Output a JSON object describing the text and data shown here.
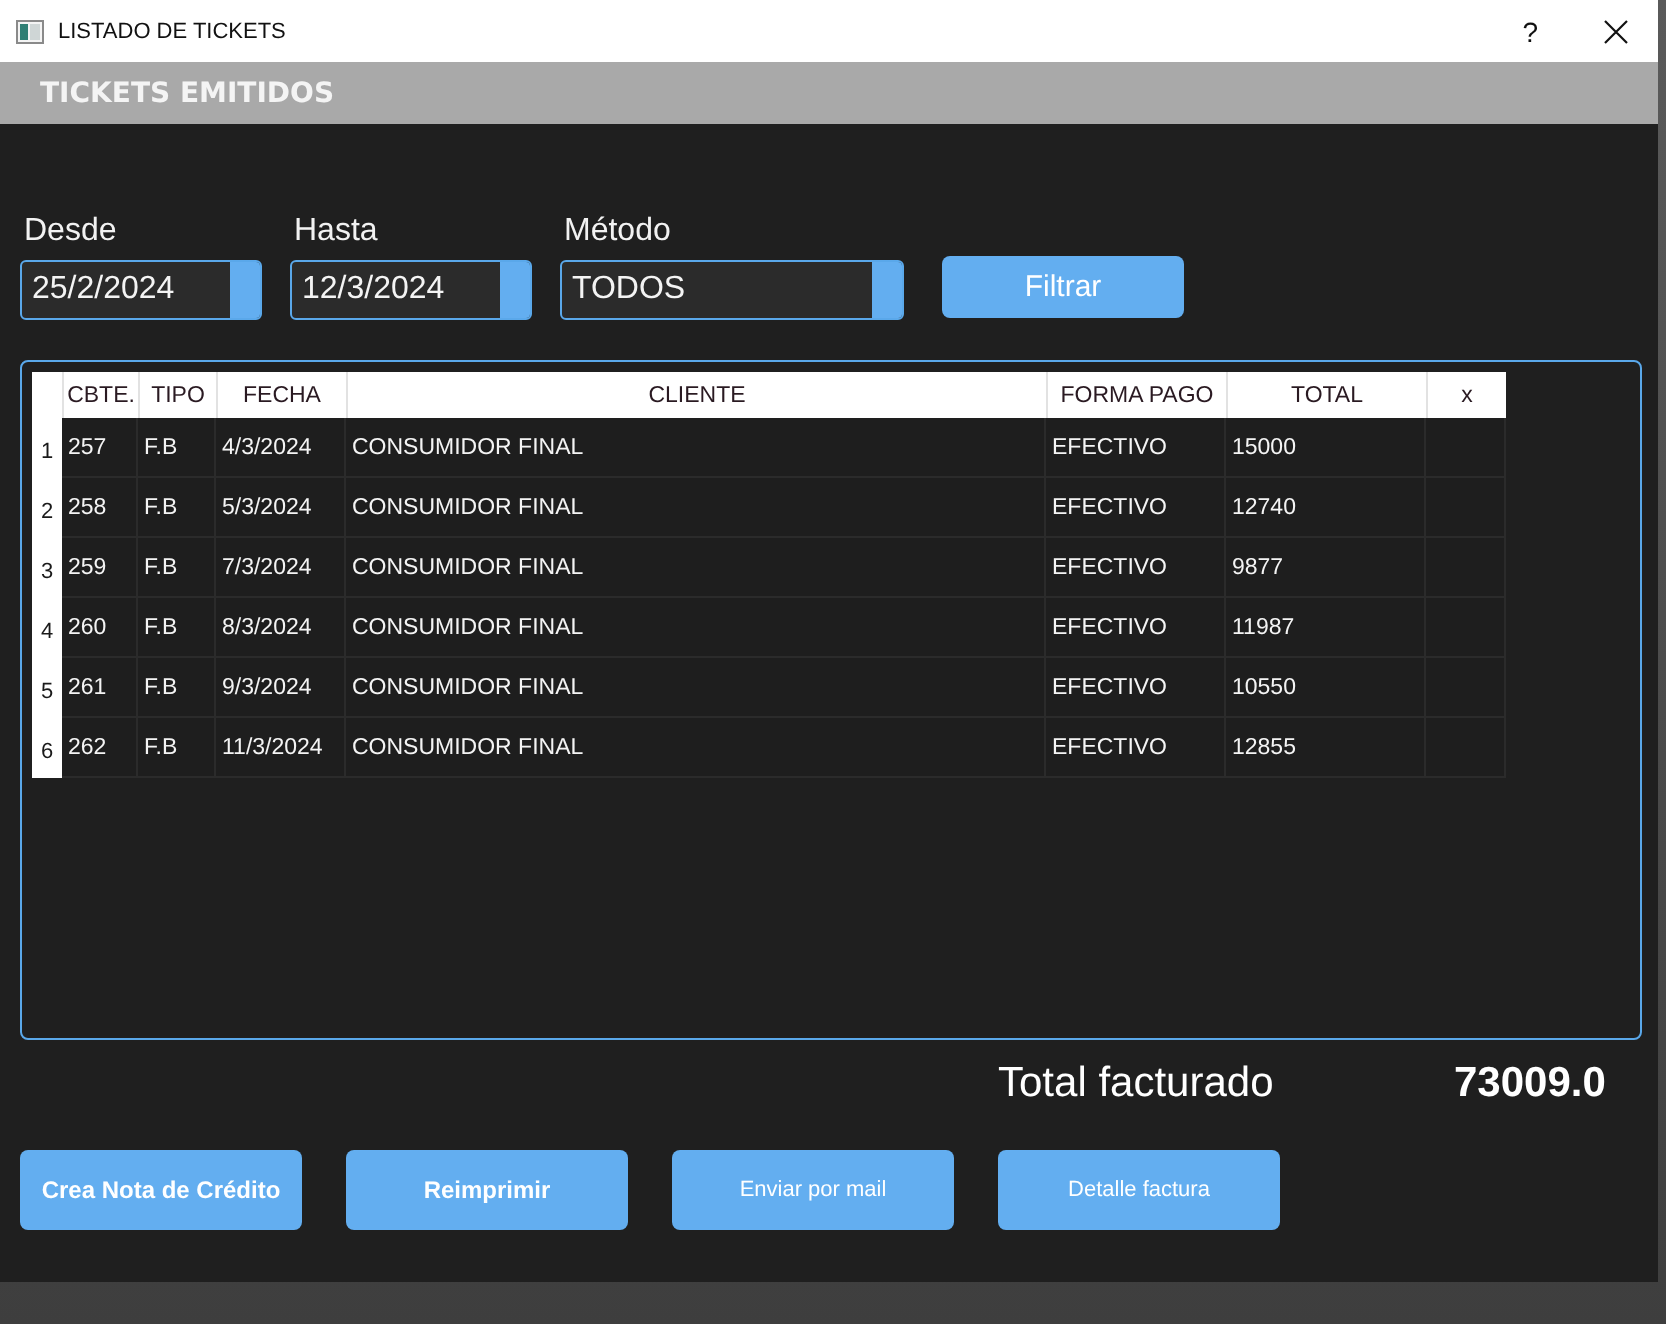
{
  "window": {
    "title": "LISTADO DE TICKETS",
    "help": "?"
  },
  "header": {
    "title": "TICKETS EMITIDOS"
  },
  "filters": [
    {
      "kind": "date",
      "label": "Desde",
      "value": "25/2/2024"
    },
    {
      "kind": "date",
      "label": "Hasta",
      "value": "12/3/2024"
    },
    {
      "kind": "select",
      "label": "Método",
      "value": "TODOS"
    }
  ],
  "filter_button": "Filtrar",
  "table": {
    "columns": [
      "CBTE.",
      "TIPO",
      "FECHA",
      "CLIENTE",
      "FORMA PAGO",
      "TOTAL",
      "x"
    ],
    "rows": [
      {
        "number": "1",
        "cells": [
          "257",
          "F.B",
          "4/3/2024",
          "CONSUMIDOR FINAL",
          "EFECTIVO",
          "15000"
        ]
      },
      {
        "number": "2",
        "cells": [
          "258",
          "F.B",
          "5/3/2024",
          "CONSUMIDOR FINAL",
          "EFECTIVO",
          "12740"
        ]
      },
      {
        "number": "3",
        "cells": [
          "259",
          "F.B",
          "7/3/2024",
          "CONSUMIDOR FINAL",
          "EFECTIVO",
          "9877"
        ]
      },
      {
        "number": "4",
        "cells": [
          "260",
          "F.B",
          "8/3/2024",
          "CONSUMIDOR FINAL",
          "EFECTIVO",
          "11987"
        ]
      },
      {
        "number": "5",
        "cells": [
          "261",
          "F.B",
          "9/3/2024",
          "CONSUMIDOR FINAL",
          "EFECTIVO",
          "10550"
        ]
      },
      {
        "number": "6",
        "cells": [
          "262",
          "F.B",
          "11/3/2024",
          "CONSUMIDOR FINAL",
          "EFECTIVO",
          "12855"
        ]
      }
    ]
  },
  "total": {
    "label": "Total facturado",
    "value": "73009.0"
  },
  "actions": [
    {
      "kind": "strong",
      "label": "Crea Nota de Crédito"
    },
    {
      "kind": "strong",
      "label": "Reimprimir"
    },
    {
      "kind": "normal",
      "label": "Enviar por mail"
    },
    {
      "kind": "normal",
      "label": "Detalle factura"
    }
  ]
}
